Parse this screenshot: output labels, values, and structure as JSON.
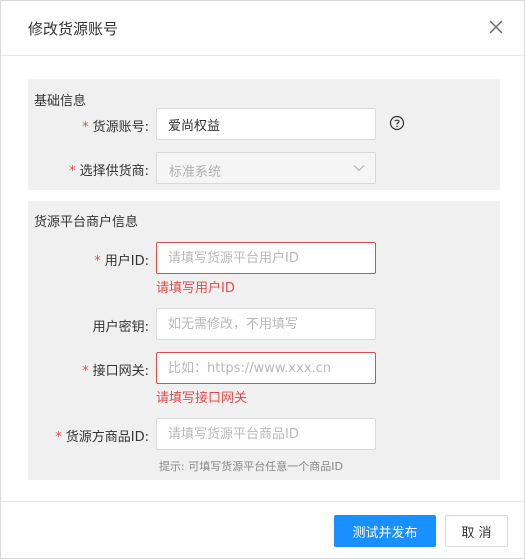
{
  "dialog": {
    "title": "修改货源账号",
    "close_icon": "close-icon"
  },
  "basic": {
    "section_title": "基础信息",
    "account_label": "货源账号:",
    "account_value": "爱尚权益",
    "help_icon": "question-circle-icon",
    "supplier_label": "选择供货商:",
    "supplier_value": "标准系统"
  },
  "merchant": {
    "section_title": "货源平台商户信息",
    "user_id_label": "用户ID:",
    "user_id_placeholder": "请填写货源平台用户ID",
    "user_id_error": "请填写用户ID",
    "user_key_label": "用户密钥:",
    "user_key_placeholder": "如无需修改，不用填写",
    "gateway_label": "接口网关:",
    "gateway_placeholder": "比如：https://www.xxx.cn",
    "gateway_error": "请填写接口网关",
    "product_id_label": "货源方商品ID:",
    "product_id_placeholder": "请填写货源平台商品ID",
    "product_id_hint": "提示: 可填写货源平台任意一个商品ID"
  },
  "footer": {
    "submit_label": "测试并发布",
    "cancel_label": "取 消"
  },
  "required_mark": "*",
  "colors": {
    "primary": "#1890ff",
    "error": "#e34b4b",
    "section_bg": "#f0f0f0"
  }
}
